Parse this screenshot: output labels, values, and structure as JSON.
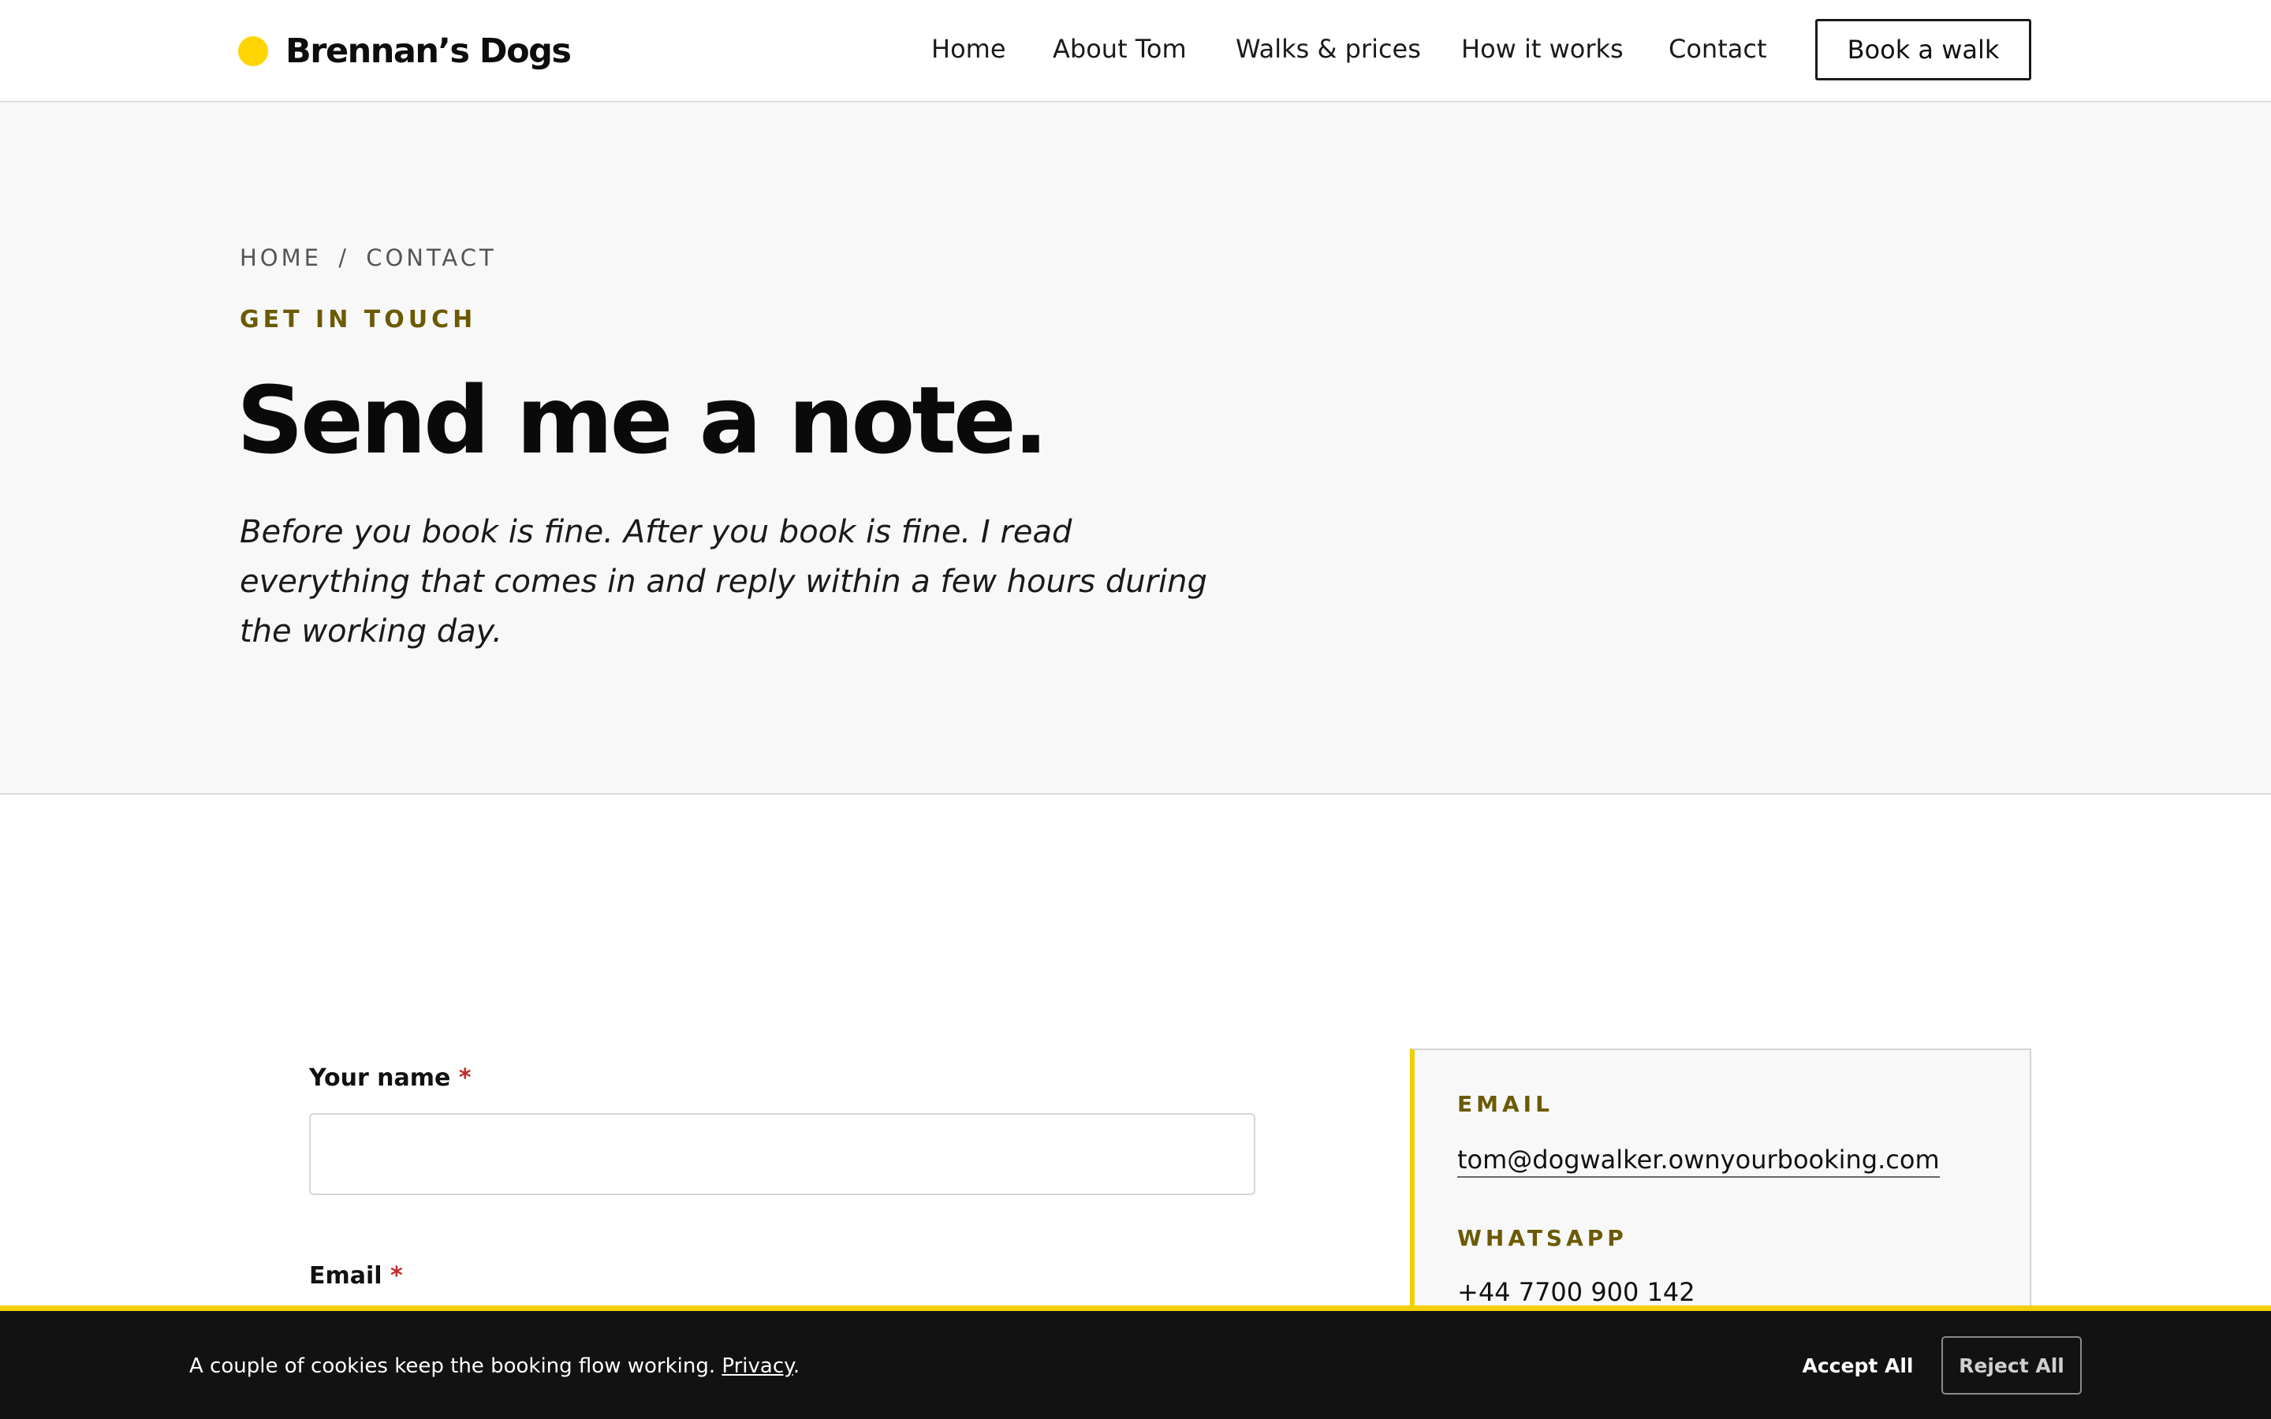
{
  "brand": {
    "name": "Brennan’s Dogs",
    "dot_color": "#ffd400"
  },
  "nav": {
    "items": [
      {
        "label": "Home"
      },
      {
        "label": "About Tom"
      },
      {
        "label": "Walks & prices"
      },
      {
        "label": "How it works"
      },
      {
        "label": "Contact"
      }
    ],
    "cta_label": "Book a walk"
  },
  "hero": {
    "breadcrumb": {
      "home": "HOME",
      "separator": "/",
      "current": "CONTACT"
    },
    "eyebrow": "GET IN TOUCH",
    "title": "Send me a note.",
    "lede": "Before you book is fine. After you book is fine. I read everything that comes in and reply within a few hours during the working day."
  },
  "form": {
    "name_label": "Your name",
    "name_value": "",
    "email_label": "Email",
    "required_mark": "*"
  },
  "contact_card": {
    "email_label": "EMAIL",
    "email_value": "tom@dogwalker.ownyourbooking.com",
    "whatsapp_label": "WHATSAPP",
    "whatsapp_value": "+44 7700 900 142",
    "accent_color": "#f2cf00"
  },
  "cookie": {
    "text": "A couple of cookies keep the booking flow working.",
    "link_label": "Privacy",
    "trailing": ".",
    "accept_label": "Accept All",
    "reject_label": "Reject All"
  }
}
